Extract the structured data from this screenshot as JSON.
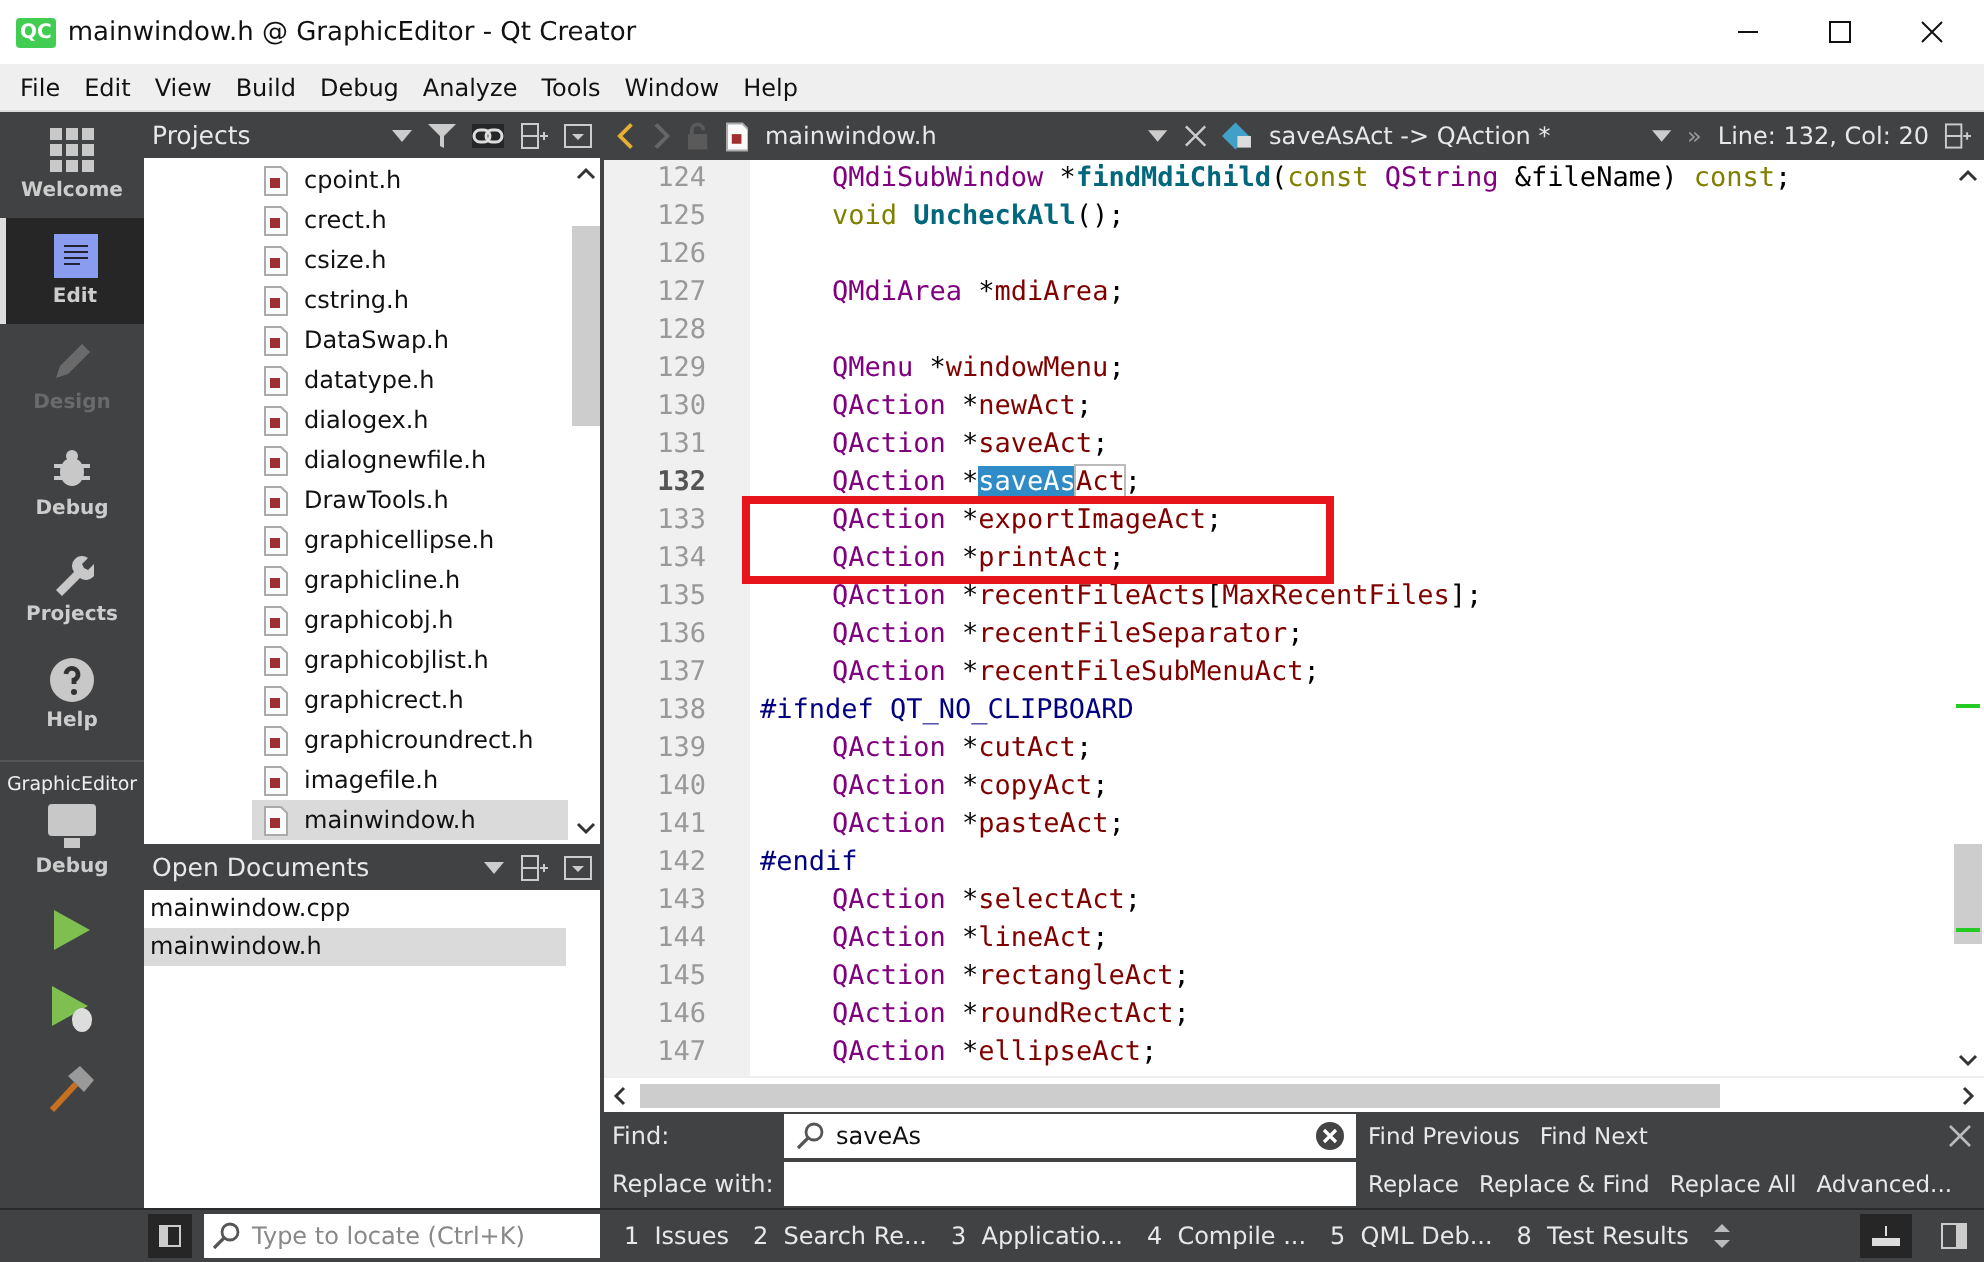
{
  "window": {
    "title": "mainwindow.h @ GraphicEditor - Qt Creator",
    "app_icon": "QC"
  },
  "menu": [
    {
      "label": "File"
    },
    {
      "label": "Edit"
    },
    {
      "label": "View"
    },
    {
      "label": "Build"
    },
    {
      "label": "Debug"
    },
    {
      "label": "Analyze"
    },
    {
      "label": "Tools"
    },
    {
      "label": "Window"
    },
    {
      "label": "Help"
    }
  ],
  "modes": [
    {
      "kind": "welcome",
      "label": "Welcome",
      "selected": false,
      "disabled": false
    },
    {
      "kind": "edit",
      "label": "Edit",
      "selected": true,
      "disabled": false
    },
    {
      "kind": "design",
      "label": "Design",
      "selected": false,
      "disabled": true
    },
    {
      "kind": "debug",
      "label": "Debug",
      "selected": false,
      "disabled": false
    },
    {
      "kind": "projects",
      "label": "Projects",
      "selected": false,
      "disabled": false
    },
    {
      "kind": "help",
      "label": "Help",
      "selected": false,
      "disabled": false
    }
  ],
  "kit": {
    "project": "GraphicEditor",
    "build": "Debug"
  },
  "projects": {
    "title": "Projects",
    "files": [
      {
        "name": "cpoint.h",
        "selected": false
      },
      {
        "name": "crect.h",
        "selected": false
      },
      {
        "name": "csize.h",
        "selected": false
      },
      {
        "name": "cstring.h",
        "selected": false
      },
      {
        "name": "DataSwap.h",
        "selected": false
      },
      {
        "name": "datatype.h",
        "selected": false
      },
      {
        "name": "dialogex.h",
        "selected": false
      },
      {
        "name": "dialognewfile.h",
        "selected": false
      },
      {
        "name": "DrawTools.h",
        "selected": false
      },
      {
        "name": "graphicellipse.h",
        "selected": false
      },
      {
        "name": "graphicline.h",
        "selected": false
      },
      {
        "name": "graphicobj.h",
        "selected": false
      },
      {
        "name": "graphicobjlist.h",
        "selected": false
      },
      {
        "name": "graphicrect.h",
        "selected": false
      },
      {
        "name": "graphicroundrect.h",
        "selected": false
      },
      {
        "name": "imagefile.h",
        "selected": false
      },
      {
        "name": "mainwindow.h",
        "selected": true
      }
    ]
  },
  "open_documents": {
    "title": "Open Documents",
    "files": [
      {
        "name": "mainwindow.cpp",
        "selected": false
      },
      {
        "name": "mainwindow.h",
        "selected": true
      }
    ]
  },
  "editor": {
    "file": "mainwindow.h",
    "symbol": "saveAsAct -> QAction *",
    "position": "Line: 132, Col: 20",
    "more": "»",
    "lines": [
      {
        "number": "124",
        "current": false,
        "boxed": false,
        "indented": true,
        "tokens": [
          {
            "kind": "type",
            "text": "QMdiSubWindow"
          },
          {
            "kind": "plain",
            "text": " *"
          },
          {
            "kind": "func",
            "text": "findMdiChild"
          },
          {
            "kind": "plain",
            "text": "("
          },
          {
            "kind": "keyword",
            "text": "const"
          },
          {
            "kind": "type",
            "text": " QString"
          },
          {
            "kind": "plain",
            "text": " &fileName) "
          },
          {
            "kind": "keyword",
            "text": "const"
          },
          {
            "kind": "plain",
            "text": ";"
          }
        ]
      },
      {
        "number": "125",
        "current": false,
        "boxed": false,
        "indented": true,
        "tokens": [
          {
            "kind": "keyword",
            "text": "void"
          },
          {
            "kind": "func",
            "text": " UncheckAll"
          },
          {
            "kind": "plain",
            "text": "();"
          }
        ]
      },
      {
        "number": "126",
        "current": false,
        "boxed": false
      },
      {
        "number": "127",
        "current": false,
        "boxed": false,
        "indented": true,
        "tokens": [
          {
            "kind": "type",
            "text": "QMdiArea"
          },
          {
            "kind": "plain",
            "text": " *"
          },
          {
            "kind": "var",
            "text": "mdiArea"
          },
          {
            "kind": "plain",
            "text": ";"
          }
        ]
      },
      {
        "number": "128",
        "current": false,
        "boxed": false
      },
      {
        "number": "129",
        "current": false,
        "boxed": false,
        "indented": true,
        "tokens": [
          {
            "kind": "type",
            "text": "QMenu"
          },
          {
            "kind": "plain",
            "text": " *"
          },
          {
            "kind": "var",
            "text": "windowMenu"
          },
          {
            "kind": "plain",
            "text": ";"
          }
        ]
      },
      {
        "number": "130",
        "current": false,
        "boxed": false,
        "indented": true,
        "tokens": [
          {
            "kind": "type",
            "text": "QAction"
          },
          {
            "kind": "plain",
            "text": " *"
          },
          {
            "kind": "var",
            "text": "newAct"
          },
          {
            "kind": "plain",
            "text": ";"
          }
        ]
      },
      {
        "number": "131",
        "current": false,
        "boxed": false,
        "indented": true,
        "tokens": [
          {
            "kind": "type",
            "text": "QAction"
          },
          {
            "kind": "plain",
            "text": " *"
          },
          {
            "kind": "var",
            "text": "saveAct"
          },
          {
            "kind": "plain",
            "text": ";"
          }
        ]
      },
      {
        "number": "132",
        "current": true,
        "boxed": false,
        "indented": true,
        "tokens": [
          {
            "kind": "type",
            "text": "QAction"
          },
          {
            "kind": "plain",
            "text": " *"
          },
          {
            "kind": "selection",
            "text": "saveAs"
          },
          {
            "kind": "match",
            "text": "Act"
          },
          {
            "kind": "plain",
            "text": ";"
          }
        ]
      },
      {
        "number": "133",
        "current": false,
        "boxed": true,
        "indented": true,
        "tokens": [
          {
            "kind": "type",
            "text": "QAction"
          },
          {
            "kind": "plain",
            "text": " *"
          },
          {
            "kind": "var",
            "text": "exportImageAct"
          },
          {
            "kind": "plain",
            "text": ";"
          }
        ]
      },
      {
        "number": "134",
        "current": false,
        "boxed": true,
        "indented": true,
        "tokens": [
          {
            "kind": "type",
            "text": "QAction"
          },
          {
            "kind": "plain",
            "text": " *"
          },
          {
            "kind": "var",
            "text": "printAct"
          },
          {
            "kind": "plain",
            "text": ";"
          }
        ]
      },
      {
        "number": "135",
        "current": false,
        "boxed": false,
        "indented": true,
        "tokens": [
          {
            "kind": "type",
            "text": "QAction"
          },
          {
            "kind": "plain",
            "text": " *"
          },
          {
            "kind": "var",
            "text": "recentFileActs"
          },
          {
            "kind": "plain",
            "text": "["
          },
          {
            "kind": "var",
            "text": "MaxRecentFiles"
          },
          {
            "kind": "plain",
            "text": "];"
          }
        ]
      },
      {
        "number": "136",
        "current": false,
        "boxed": false,
        "indented": true,
        "tokens": [
          {
            "kind": "type",
            "text": "QAction"
          },
          {
            "kind": "plain",
            "text": " *"
          },
          {
            "kind": "var",
            "text": "recentFileSeparator"
          },
          {
            "kind": "plain",
            "text": ";"
          }
        ]
      },
      {
        "number": "137",
        "current": false,
        "boxed": false,
        "indented": true,
        "tokens": [
          {
            "kind": "type",
            "text": "QAction"
          },
          {
            "kind": "plain",
            "text": " *"
          },
          {
            "kind": "var",
            "text": "recentFileSubMenuAct"
          },
          {
            "kind": "plain",
            "text": ";"
          }
        ]
      },
      {
        "number": "138",
        "current": false,
        "boxed": false,
        "indented": false,
        "tokens": [
          {
            "kind": "preproc",
            "text": "#ifndef QT_NO_CLIPBOARD"
          }
        ]
      },
      {
        "number": "139",
        "current": false,
        "boxed": false,
        "indented": true,
        "tokens": [
          {
            "kind": "type",
            "text": "QAction"
          },
          {
            "kind": "plain",
            "text": " *"
          },
          {
            "kind": "var",
            "text": "cutAct"
          },
          {
            "kind": "plain",
            "text": ";"
          }
        ]
      },
      {
        "number": "140",
        "current": false,
        "boxed": false,
        "indented": true,
        "tokens": [
          {
            "kind": "type",
            "text": "QAction"
          },
          {
            "kind": "plain",
            "text": " *"
          },
          {
            "kind": "var",
            "text": "copyAct"
          },
          {
            "kind": "plain",
            "text": ";"
          }
        ]
      },
      {
        "number": "141",
        "current": false,
        "boxed": false,
        "indented": true,
        "tokens": [
          {
            "kind": "type",
            "text": "QAction"
          },
          {
            "kind": "plain",
            "text": " *"
          },
          {
            "kind": "var",
            "text": "pasteAct"
          },
          {
            "kind": "plain",
            "text": ";"
          }
        ]
      },
      {
        "number": "142",
        "current": false,
        "boxed": false,
        "indented": false,
        "tokens": [
          {
            "kind": "preproc",
            "text": "#endif"
          }
        ]
      },
      {
        "number": "143",
        "current": false,
        "boxed": false,
        "indented": true,
        "tokens": [
          {
            "kind": "type",
            "text": "QAction"
          },
          {
            "kind": "plain",
            "text": " *"
          },
          {
            "kind": "var",
            "text": "selectAct"
          },
          {
            "kind": "plain",
            "text": ";"
          }
        ]
      },
      {
        "number": "144",
        "current": false,
        "boxed": false,
        "indented": true,
        "tokens": [
          {
            "kind": "type",
            "text": "QAction"
          },
          {
            "kind": "plain",
            "text": " *"
          },
          {
            "kind": "var",
            "text": "lineAct"
          },
          {
            "kind": "plain",
            "text": ";"
          }
        ]
      },
      {
        "number": "145",
        "current": false,
        "boxed": false,
        "indented": true,
        "tokens": [
          {
            "kind": "type",
            "text": "QAction"
          },
          {
            "kind": "plain",
            "text": " *"
          },
          {
            "kind": "var",
            "text": "rectangleAct"
          },
          {
            "kind": "plain",
            "text": ";"
          }
        ]
      },
      {
        "number": "146",
        "current": false,
        "boxed": false,
        "indented": true,
        "tokens": [
          {
            "kind": "type",
            "text": "QAction"
          },
          {
            "kind": "plain",
            "text": " *"
          },
          {
            "kind": "var",
            "text": "roundRectAct"
          },
          {
            "kind": "plain",
            "text": ";"
          }
        ]
      },
      {
        "number": "147",
        "current": false,
        "boxed": false,
        "indented": true,
        "tokens": [
          {
            "kind": "type",
            "text": "QAction"
          },
          {
            "kind": "plain",
            "text": " *"
          },
          {
            "kind": "var",
            "text": "ellipseAct"
          },
          {
            "kind": "plain",
            "text": ";"
          }
        ]
      }
    ]
  },
  "find": {
    "find_label": "Find:",
    "find_value": "saveAs",
    "replace_label": "Replace with:",
    "buttons_top": [
      "Find Previous",
      "Find Next"
    ],
    "buttons_bottom": [
      "Replace",
      "Replace & Find",
      "Replace All",
      "Advanced..."
    ]
  },
  "locator": {
    "placeholder": "Type to locate (Ctrl+K)"
  },
  "output_tabs": [
    {
      "number": "1",
      "label": "Issues"
    },
    {
      "number": "2",
      "label": "Search Re..."
    },
    {
      "number": "3",
      "label": "Applicatio..."
    },
    {
      "number": "4",
      "label": "Compile ..."
    },
    {
      "number": "5",
      "label": "QML Deb..."
    },
    {
      "number": "8",
      "label": "Test Results"
    }
  ]
}
